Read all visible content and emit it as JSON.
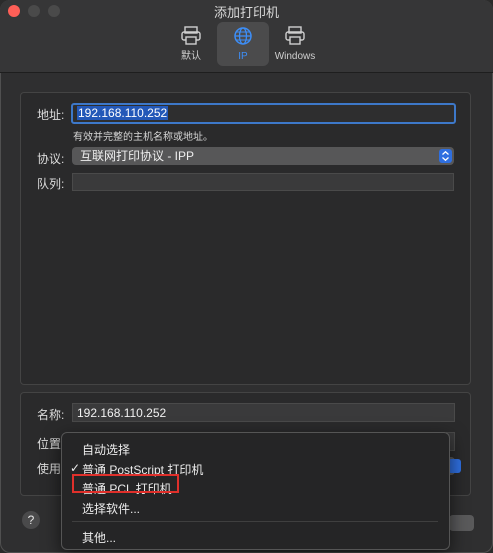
{
  "window": {
    "title": "添加打印机"
  },
  "tabs": [
    {
      "label": "默认"
    },
    {
      "label": "IP"
    },
    {
      "label": "Windows"
    }
  ],
  "form": {
    "address_label": "地址:",
    "address_value": "192.168.110.252",
    "address_hint": "有效并完整的主机名称或地址。",
    "protocol_label": "协议:",
    "protocol_value": "互联网打印协议 - IPP",
    "queue_label": "队列:",
    "queue_value": ""
  },
  "details": {
    "name_label": "名称:",
    "name_value": "192.168.110.252",
    "location_label": "位置",
    "use_label": "使用"
  },
  "menu": {
    "items": [
      {
        "label": "自动选择"
      },
      {
        "label": "普通 PostScript 打印机",
        "checked": true
      },
      {
        "label": "普通 PCL 打印机",
        "highlighted": true
      },
      {
        "label": "选择软件..."
      },
      {
        "label": "其他..."
      }
    ],
    "check_glyph": "✓"
  },
  "help": {
    "label": "?"
  },
  "colors": {
    "accent": "#3d8ef7",
    "highlight_box": "#e0302b"
  }
}
